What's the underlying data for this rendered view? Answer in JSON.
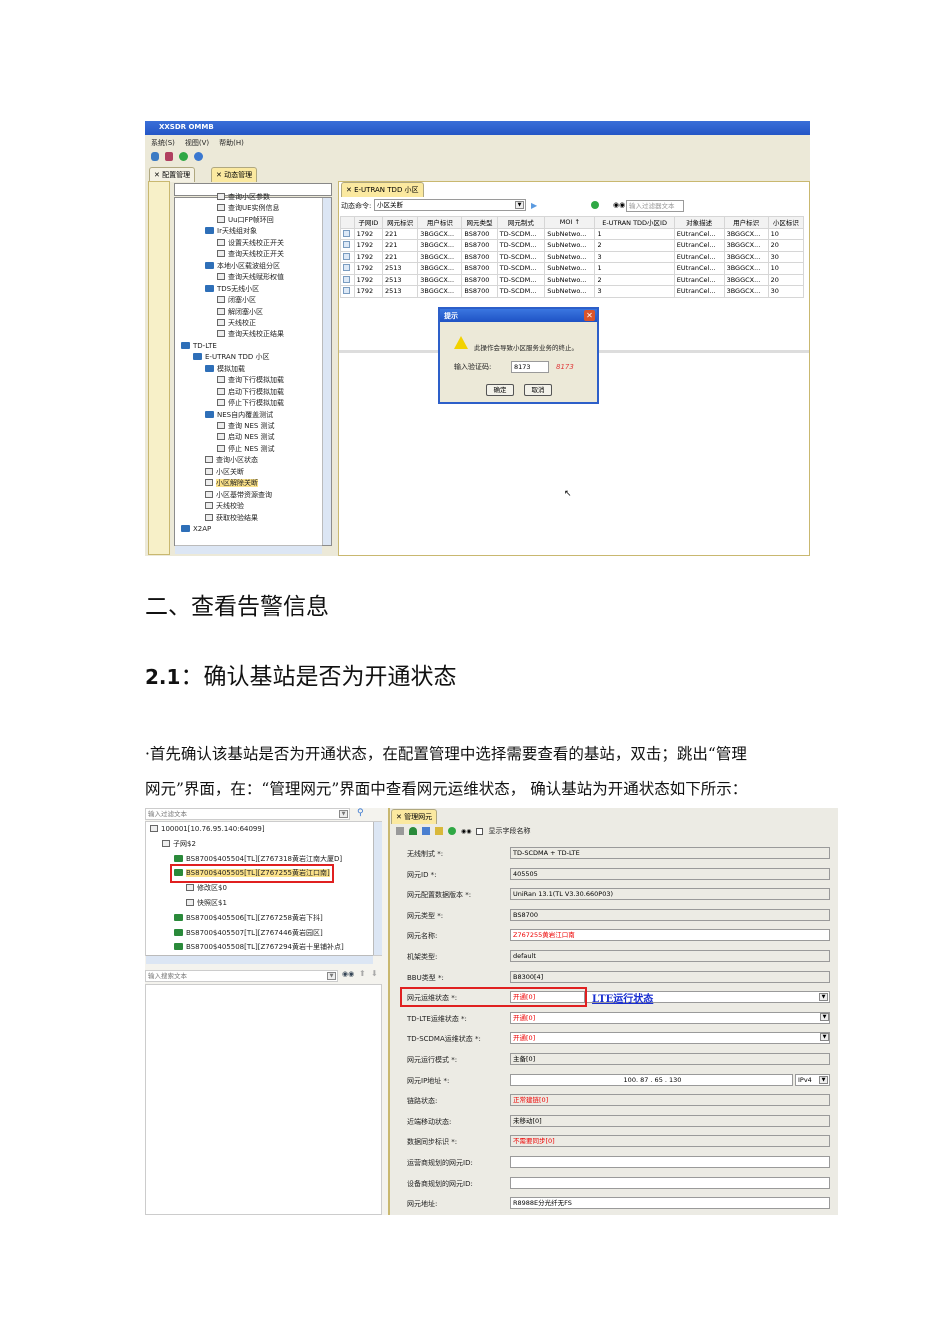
{
  "shot1": {
    "window_title": "XXSDR OMMB",
    "menu": [
      "系统(S)",
      "视图(V)",
      "帮助(H)"
    ],
    "main_tabs": [
      "配置管理",
      "动态管理"
    ],
    "tree": [
      {
        "label": "查询小区参数",
        "level": 3,
        "folder": false
      },
      {
        "label": "查询UE实例信息",
        "level": 3,
        "folder": false
      },
      {
        "label": "Uu口FP帧环回",
        "level": 3,
        "folder": false
      },
      {
        "label": "Ir天线组对象",
        "level": 2,
        "folder": true
      },
      {
        "label": "设置天线校正开关",
        "level": 3,
        "folder": false
      },
      {
        "label": "查询天线校正开关",
        "level": 3,
        "folder": false
      },
      {
        "label": "本地小区载波组分区",
        "level": 2,
        "folder": true
      },
      {
        "label": "查询天线赋形权值",
        "level": 3,
        "folder": false
      },
      {
        "label": "TDS无线小区",
        "level": 2,
        "folder": true
      },
      {
        "label": "闭塞小区",
        "level": 3,
        "folder": false
      },
      {
        "label": "解闭塞小区",
        "level": 3,
        "folder": false
      },
      {
        "label": "天线校正",
        "level": 3,
        "folder": false
      },
      {
        "label": "查询天线校正结果",
        "level": 3,
        "folder": false
      },
      {
        "label": "TD-LTE",
        "level": 0,
        "folder": true
      },
      {
        "label": "E-UTRAN TDD 小区",
        "level": 1,
        "folder": true
      },
      {
        "label": "模拟加载",
        "level": 2,
        "folder": true
      },
      {
        "label": "查询下行模拟加载",
        "level": 3,
        "folder": false
      },
      {
        "label": "启动下行模拟加载",
        "level": 3,
        "folder": false
      },
      {
        "label": "停止下行模拟加载",
        "level": 3,
        "folder": false
      },
      {
        "label": "NES自内覆盖测试",
        "level": 2,
        "folder": true
      },
      {
        "label": "查询 NES 测试",
        "level": 3,
        "folder": false
      },
      {
        "label": "启动 NES 测试",
        "level": 3,
        "folder": false
      },
      {
        "label": "停止 NES 测试",
        "level": 3,
        "folder": false
      },
      {
        "label": "查询小区状态",
        "level": 2,
        "folder": false
      },
      {
        "label": "小区关断",
        "level": 2,
        "folder": false
      },
      {
        "label": "小区解除关断",
        "level": 2,
        "folder": false,
        "selected": true
      },
      {
        "label": "小区基带资源查询",
        "level": 2,
        "folder": false
      },
      {
        "label": "天线校验",
        "level": 2,
        "folder": false
      },
      {
        "label": "获取校验结果",
        "level": 2,
        "folder": false
      },
      {
        "label": "X2AP",
        "level": 0,
        "folder": true
      }
    ],
    "content_tab": "E-UTRAN TDD 小区",
    "command_label": "动态命令:",
    "command_value": "小区关断",
    "filter_placeholder": "输入过滤器文本",
    "table": {
      "columns": [
        "子网ID",
        "网元标识",
        "用户标识",
        "网元类型",
        "网元制式",
        "MOI ↑",
        "E-UTRAN TDD小区ID",
        "对象描述",
        "用户标识",
        "小区标识"
      ],
      "rows": [
        [
          "1792",
          "221",
          "3BGGCX...",
          "BS8700",
          "TD-SCDM...",
          "SubNetwo...",
          "1",
          "EUtranCel...",
          "3BGGCX...",
          "10"
        ],
        [
          "1792",
          "221",
          "3BGGCX...",
          "BS8700",
          "TD-SCDM...",
          "SubNetwo...",
          "2",
          "EUtranCel...",
          "3BGGCX...",
          "20"
        ],
        [
          "1792",
          "221",
          "3BGGCX...",
          "BS8700",
          "TD-SCDM...",
          "SubNetwo...",
          "3",
          "EUtranCel...",
          "3BGGCX...",
          "30"
        ],
        [
          "1792",
          "2513",
          "3BGGCX...",
          "BS8700",
          "TD-SCDM...",
          "SubNetwo...",
          "1",
          "EUtranCel...",
          "3BGGCX...",
          "10"
        ],
        [
          "1792",
          "2513",
          "3BGGCX...",
          "BS8700",
          "TD-SCDM...",
          "SubNetwo...",
          "2",
          "EUtranCel...",
          "3BGGCX...",
          "20"
        ],
        [
          "1792",
          "2513",
          "3BGGCX...",
          "BS8700",
          "TD-SCDM...",
          "SubNetwo...",
          "3",
          "EUtranCel...",
          "3BGGCX...",
          "30"
        ]
      ]
    },
    "dialog": {
      "title": "提示",
      "message": "此操作会导致小区服务业务的终止。",
      "code_label": "输入验证码:",
      "code_value": "8173",
      "code_hint": "8173",
      "ok": "确定",
      "cancel": "取消"
    }
  },
  "heading1": "二、查看告警信息",
  "heading2_num": "2.1",
  "heading2_text": "：确认基站是否为开通状态",
  "para_line1": "·首先确认该基站是否为开通状态，在配置管理中选择需要查看的基站，双击；跳出“管理",
  "para_line2": "网元”界面，在：“管理网元”界面中查看网元运维状态，  确认基站为开通状态如下所示：",
  "shot2": {
    "filter_placeholder": "输入过滤文本",
    "search_placeholder": "输入搜索文本",
    "tree": [
      {
        "label": "100001[10.76.95.140:64099]",
        "level": 0
      },
      {
        "label": "子网$2",
        "level": 1
      },
      {
        "label": "BS8700$405504[TL][Z767318黄岩江南大厦D]",
        "level": 2
      },
      {
        "label": "BS8700$405505[TL][Z767255黄岩江口南]",
        "level": 2,
        "selected": true
      },
      {
        "label": "修改区$0",
        "level": 3
      },
      {
        "label": "快照区$1",
        "level": 3
      },
      {
        "label": "BS8700$405506[TL][Z767258黄岩下抖]",
        "level": 2
      },
      {
        "label": "BS8700$405507[TL][Z767446黄岩园区]",
        "level": 2
      },
      {
        "label": "BS8700$405508[TL][Z767294黄岩十里铺补点]",
        "level": 2
      }
    ],
    "tab": "管理网元",
    "show_field_names": "显示字段名称",
    "annotation": "LTE运行状态",
    "form": [
      {
        "label": "无线制式 *:",
        "value": "TD-SCDMA + TD-LTE",
        "style": "grey"
      },
      {
        "label": "网元ID *:",
        "value": "405505",
        "style": "grey"
      },
      {
        "label": "网元配置数据版本 *:",
        "value": "UniRan 13.1(TL V3.30.660P03)",
        "style": "grey"
      },
      {
        "label": "网元类型 *:",
        "value": "BS8700",
        "style": "grey"
      },
      {
        "label": "网元名称:",
        "value": "Z767255黄岩江口南",
        "style": "white red"
      },
      {
        "label": "机架类型:",
        "value": "default",
        "style": "grey"
      },
      {
        "label": "BBU类型 *:",
        "value": "B8300[4]",
        "style": "grey"
      },
      {
        "label": "网元运维状态 *:",
        "value": "开通[0]",
        "style": "white red",
        "dropdown": true,
        "boxed": true
      },
      {
        "label": "TD-LTE运维状态 *:",
        "value": "开通[0]",
        "style": "white red",
        "dropdown": true
      },
      {
        "label": "TD-SCDMA运维状态 *:",
        "value": "开通[0]",
        "style": "white red",
        "dropdown": true
      },
      {
        "label": "网元运行模式 *:",
        "value": "主备[0]",
        "style": "grey"
      },
      {
        "label": "网元IP地址 *:",
        "value": "100. 87 . 65 . 130",
        "style": "white",
        "ip": true,
        "ip_type": "IPv4"
      },
      {
        "label": "链路状态:",
        "value": "正常建链[0]",
        "style": "grey red"
      },
      {
        "label": "近端移动状态:",
        "value": "未移动[0]",
        "style": "grey"
      },
      {
        "label": "数据同步标识 *:",
        "value": "不需要同步[0]",
        "style": "grey red"
      },
      {
        "label": "运营商规划的网元ID:",
        "value": "",
        "style": "white"
      },
      {
        "label": "设备商规划的网元ID:",
        "value": "",
        "style": "white"
      },
      {
        "label": "网元地址:",
        "value": "R8988E分光纤无FS",
        "style": "white"
      }
    ]
  }
}
